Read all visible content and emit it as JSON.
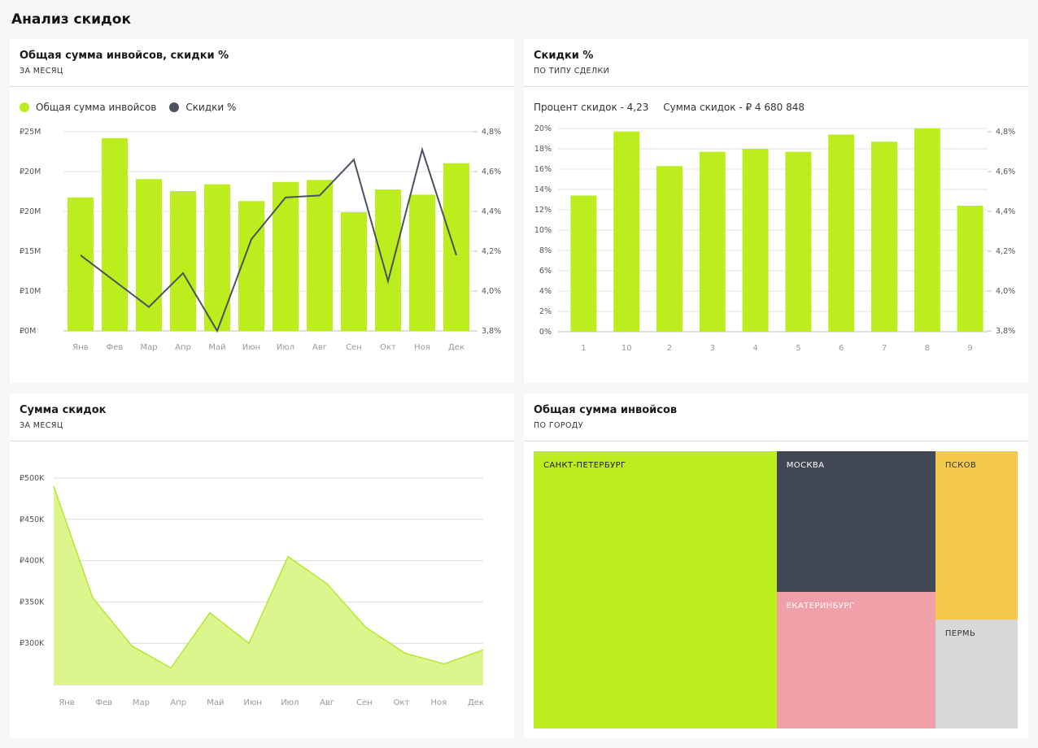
{
  "page": {
    "title": "Анализ скидок"
  },
  "cards": {
    "invoices_discounts": {
      "title": "Общая сумма инвойсов, скидки %",
      "subtitle": "ЗА МЕСЯЦ"
    },
    "discounts_by_deal": {
      "title": "Скидки %",
      "subtitle": "ПО ТИПУ СДЕЛКИ",
      "stat_pct": "Процент скидок  - 4,23",
      "stat_sum": "Сумма скидок - ₽ 4 680 848"
    },
    "discount_sum": {
      "title": "Сумма скидок",
      "subtitle": "ЗА МЕСЯЦ"
    },
    "invoices_by_city": {
      "title": "Общая сумма инвойсов",
      "subtitle": "ПО ГОРОДУ"
    }
  },
  "colors": {
    "accent": "#bcee1d",
    "dark": "#414754",
    "line": "#4b5260",
    "area": "#dcf58c",
    "pink": "#efa0a8",
    "yellow": "#f5c84e",
    "grey": "#d8d8d8"
  },
  "chart_data": [
    {
      "type": "bar",
      "categories": [
        "Янв",
        "Фев",
        "Мар",
        "Апр",
        "Май",
        "Июн",
        "Июл",
        "Авг",
        "Сен",
        "Окт",
        "Ноя",
        "Дек"
      ],
      "y_ticks": [
        "₽0M",
        "₽10M",
        "₽15M",
        "₽20M",
        "₽20M",
        "₽25M"
      ],
      "y2_ticks": [
        "3,8%",
        "4,0%",
        "4,2%",
        "4,4%",
        "4,6%",
        "4,8%"
      ],
      "series": [
        {
          "name": "Общая сумма инвойсов",
          "type": "bar",
          "values": [
            3.35,
            4.84,
            3.81,
            3.51,
            3.68,
            3.26,
            3.74,
            3.79,
            2.98,
            3.55,
            3.42,
            4.21
          ]
        },
        {
          "name": "Скидки %",
          "type": "line",
          "values": [
            4.18,
            4.05,
            3.92,
            4.09,
            3.8,
            4.26,
            4.47,
            4.48,
            4.66,
            4.05,
            4.71,
            4.18
          ]
        }
      ],
      "legend": "top-left"
    },
    {
      "type": "bar",
      "categories": [
        "1",
        "10",
        "2",
        "3",
        "4",
        "5",
        "6",
        "7",
        "8",
        "9"
      ],
      "values": [
        13.4,
        19.7,
        16.3,
        17.7,
        18.0,
        17.7,
        19.4,
        18.7,
        20.0,
        12.4
      ],
      "y_ticks": [
        "0%",
        "2%",
        "4%",
        "6%",
        "8%",
        "10%",
        "12%",
        "14%",
        "16%",
        "18%",
        "20%"
      ],
      "y2_ticks": [
        "3,8%",
        "4,0%",
        "4,2%",
        "4,4%",
        "4,6%",
        "4,8%"
      ],
      "ylim": [
        0,
        20
      ]
    },
    {
      "type": "area",
      "categories": [
        "Янв",
        "Фев",
        "Мар",
        "Апр",
        "Май",
        "Июн",
        "Июл",
        "Авг",
        "Сен",
        "Окт",
        "Ноя",
        "Дек"
      ],
      "values": [
        490,
        355,
        297,
        270,
        337,
        300,
        405,
        372,
        319,
        288,
        275,
        292
      ],
      "y_ticks": [
        "₽300K",
        "₽350K",
        "₽400K",
        "₽450K",
        "₽500K"
      ],
      "ylim": [
        250,
        500
      ]
    },
    {
      "type": "treemap",
      "items": [
        {
          "name": "САНКТ-ПЕТЕРБУРГ",
          "value": 50.2
        },
        {
          "name": "МОСКВА",
          "value": 16.6
        },
        {
          "name": "ЕКАТЕРИНБУРГ",
          "value": 16.2
        },
        {
          "name": "ПСКОВ",
          "value": 10.3
        },
        {
          "name": "ПЕРМЬ",
          "value": 6.7
        }
      ]
    }
  ]
}
